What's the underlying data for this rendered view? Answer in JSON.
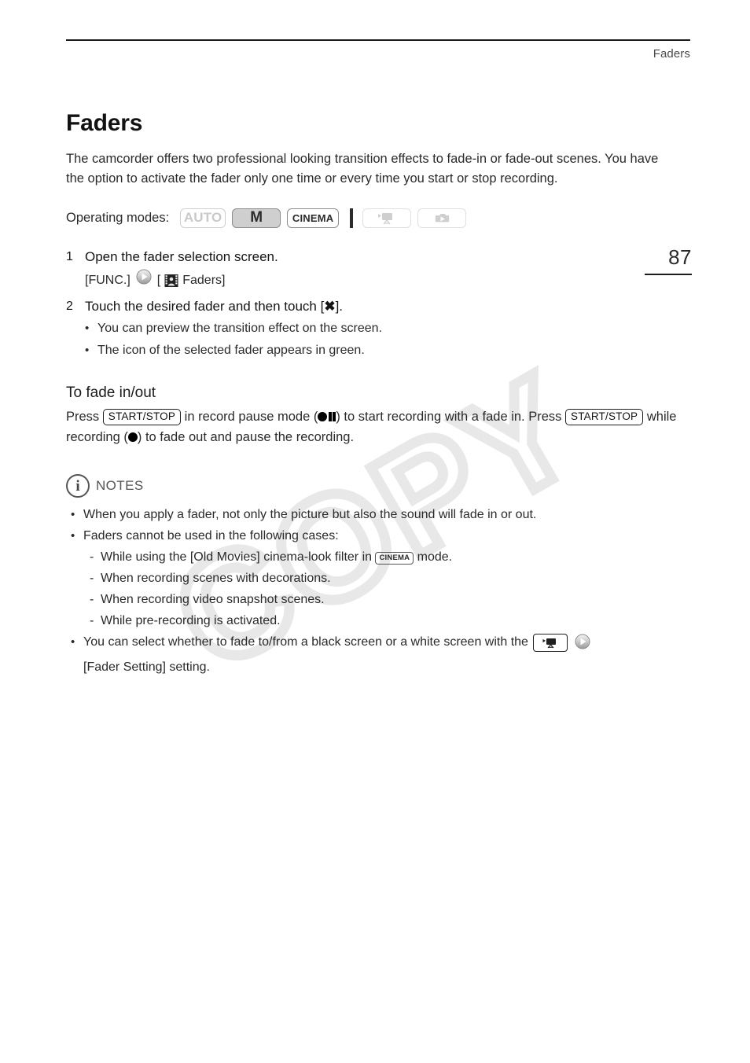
{
  "header": {
    "running_title": "Faders"
  },
  "page": {
    "number": "87"
  },
  "watermark": {
    "text": "COPY"
  },
  "main": {
    "title": "Faders",
    "intro": "The camcorder offers two professional looking transition effects to fade-in or fade-out scenes. You have the option to activate the fader only one time or every time you start or stop recording.",
    "operating_modes": {
      "label": "Operating modes:",
      "badges": [
        {
          "id": "auto",
          "label": "AUTO",
          "state": "inactive"
        },
        {
          "id": "m",
          "label": "M",
          "state": "active"
        },
        {
          "id": "cinema",
          "label": "CINEMA",
          "state": "available"
        },
        {
          "id": "movie-playback",
          "label": "camcorder-playback-icon",
          "state": "inactive"
        },
        {
          "id": "photo-playback",
          "label": "photo-playback-icon",
          "state": "inactive"
        }
      ]
    },
    "steps": [
      {
        "num": "1",
        "text": "Open the fader selection screen.",
        "path_pre": "[FUNC.]",
        "path_arrow": "arrow-right-circle-icon",
        "path_open": "[",
        "path_icon": "fader-filmstrip-icon",
        "path_label": "Faders]"
      },
      {
        "num": "2",
        "text_before": "Touch the desired fader and then touch [",
        "x_symbol": "✖",
        "text_after": "].",
        "bullets": [
          "You can preview the transition effect on the screen.",
          "The icon of the selected fader appears in green."
        ]
      }
    ],
    "subsection": {
      "heading": "To fade in/out",
      "p1_a": "Press",
      "key1": "START/STOP",
      "p1_b": "in record pause mode (",
      "rec_pause_icon": "record-pause-icon",
      "p1_c": ") to start recording with a fade in. Press",
      "key2": "START/STOP",
      "p1_d": "while recording (",
      "rec_icon": "record-dot-icon",
      "p1_e": ") to fade out and pause the recording."
    },
    "notes": {
      "icon": "info-circle-icon",
      "label": "NOTES",
      "items": [
        {
          "text": "When you apply a fader, not only the picture but also the sound will fade in or out."
        },
        {
          "text": "Faders cannot be used in the following cases:",
          "sub": [
            {
              "before": "While using the [Old Movies] cinema-look filter in",
              "badge": "CINEMA",
              "after": "mode."
            },
            {
              "before": "When recording scenes with decorations.",
              "badge": "",
              "after": ""
            },
            {
              "before": "When recording video snapshot scenes.",
              "badge": "",
              "after": ""
            },
            {
              "before": "While pre-recording is activated.",
              "badge": "",
              "after": ""
            }
          ]
        },
        {
          "before": "You can select whether to fade to/from a black screen or a white screen with the",
          "icon1": "camcorder-menu-icon",
          "icon2": "arrow-right-circle-icon",
          "after": "[Fader Setting] setting."
        }
      ]
    }
  },
  "colors": {
    "text": "#2a2a2a",
    "heading": "#111111",
    "muted": "#555555",
    "badge_inactive": "#c9c9c9",
    "badge_active_bg": "#cfcfcf",
    "watermark": "#e8e8e8"
  }
}
